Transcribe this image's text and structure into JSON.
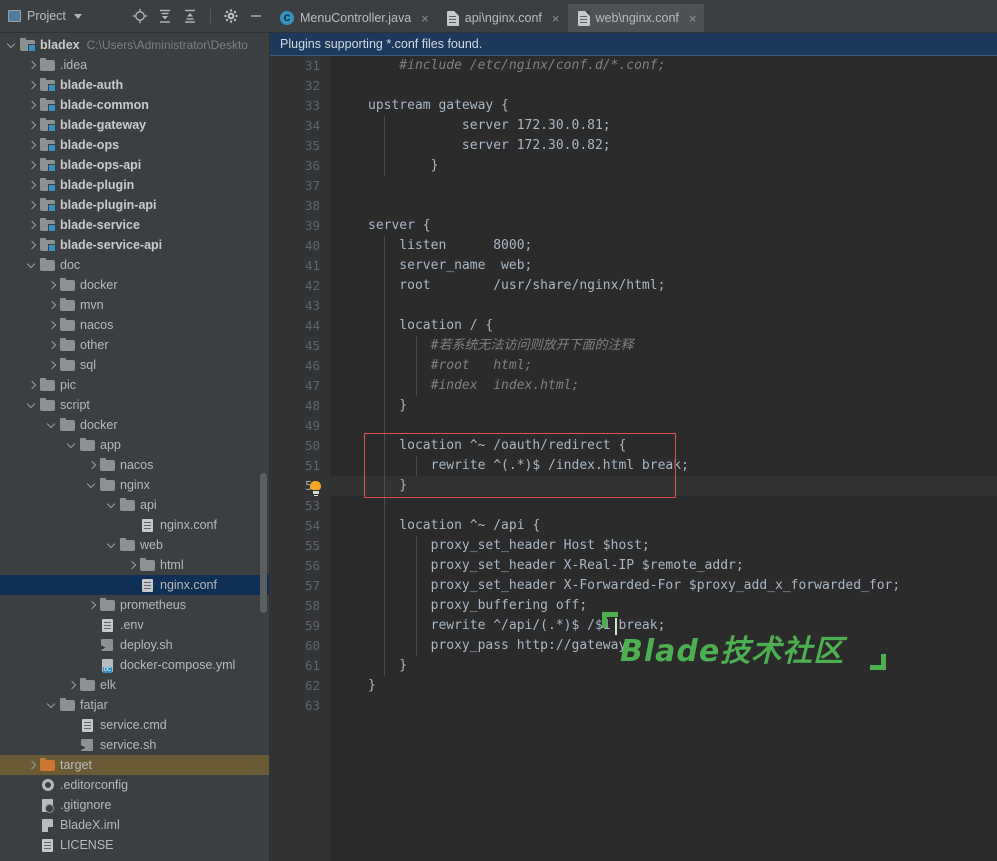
{
  "toolbar": {
    "project_label": "Project",
    "icons": [
      {
        "name": "locate-icon",
        "title": "Select Opened File"
      },
      {
        "name": "expand-all-icon",
        "title": "Expand All"
      },
      {
        "name": "collapse-all-icon",
        "title": "Collapse All"
      },
      {
        "name": "gear-icon",
        "title": "Settings"
      },
      {
        "name": "minimize-icon",
        "title": "Hide"
      }
    ]
  },
  "tabs": [
    {
      "label": "MenuController.java",
      "icon": "java-class-icon",
      "active": false,
      "close": "×"
    },
    {
      "label": "api\\nginx.conf",
      "icon": "conf-file-icon",
      "active": false,
      "close": "×"
    },
    {
      "label": "web\\nginx.conf",
      "icon": "conf-file-icon",
      "active": true,
      "close": "×"
    }
  ],
  "notification": {
    "text": "Plugins supporting *.conf files found."
  },
  "tree": [
    {
      "depth": 0,
      "arrow": "open",
      "icon": "module-folder",
      "label": "bladex",
      "bold": true,
      "path": "C:\\Users\\Administrator\\Deskto"
    },
    {
      "depth": 1,
      "arrow": "closed",
      "icon": "folder",
      "label": ".idea",
      "bold": false
    },
    {
      "depth": 1,
      "arrow": "closed",
      "icon": "module-folder",
      "label": "blade-auth",
      "bold": true
    },
    {
      "depth": 1,
      "arrow": "closed",
      "icon": "module-folder",
      "label": "blade-common",
      "bold": true
    },
    {
      "depth": 1,
      "arrow": "closed",
      "icon": "module-folder",
      "label": "blade-gateway",
      "bold": true
    },
    {
      "depth": 1,
      "arrow": "closed",
      "icon": "module-folder",
      "label": "blade-ops",
      "bold": true
    },
    {
      "depth": 1,
      "arrow": "closed",
      "icon": "module-folder",
      "label": "blade-ops-api",
      "bold": true
    },
    {
      "depth": 1,
      "arrow": "closed",
      "icon": "module-folder",
      "label": "blade-plugin",
      "bold": true
    },
    {
      "depth": 1,
      "arrow": "closed",
      "icon": "module-folder",
      "label": "blade-plugin-api",
      "bold": true
    },
    {
      "depth": 1,
      "arrow": "closed",
      "icon": "module-folder",
      "label": "blade-service",
      "bold": true
    },
    {
      "depth": 1,
      "arrow": "closed",
      "icon": "module-folder",
      "label": "blade-service-api",
      "bold": true
    },
    {
      "depth": 1,
      "arrow": "open",
      "icon": "folder",
      "label": "doc",
      "bold": false
    },
    {
      "depth": 2,
      "arrow": "closed",
      "icon": "folder",
      "label": "docker",
      "bold": false
    },
    {
      "depth": 2,
      "arrow": "closed",
      "icon": "folder",
      "label": "mvn",
      "bold": false
    },
    {
      "depth": 2,
      "arrow": "closed",
      "icon": "folder",
      "label": "nacos",
      "bold": false
    },
    {
      "depth": 2,
      "arrow": "closed",
      "icon": "folder",
      "label": "other",
      "bold": false
    },
    {
      "depth": 2,
      "arrow": "closed",
      "icon": "folder",
      "label": "sql",
      "bold": false
    },
    {
      "depth": 1,
      "arrow": "closed",
      "icon": "folder",
      "label": "pic",
      "bold": false
    },
    {
      "depth": 1,
      "arrow": "open",
      "icon": "folder",
      "label": "script",
      "bold": false
    },
    {
      "depth": 2,
      "arrow": "open",
      "icon": "folder",
      "label": "docker",
      "bold": false
    },
    {
      "depth": 3,
      "arrow": "open",
      "icon": "folder",
      "label": "app",
      "bold": false
    },
    {
      "depth": 4,
      "arrow": "closed",
      "icon": "folder",
      "label": "nacos",
      "bold": false
    },
    {
      "depth": 4,
      "arrow": "open",
      "icon": "folder",
      "label": "nginx",
      "bold": false
    },
    {
      "depth": 5,
      "arrow": "open",
      "icon": "folder",
      "label": "api",
      "bold": false
    },
    {
      "depth": 6,
      "arrow": "none",
      "icon": "conf-file",
      "label": "nginx.conf",
      "bold": false
    },
    {
      "depth": 5,
      "arrow": "open",
      "icon": "folder",
      "label": "web",
      "bold": false
    },
    {
      "depth": 6,
      "arrow": "closed",
      "icon": "folder",
      "label": "html",
      "bold": false
    },
    {
      "depth": 6,
      "arrow": "none",
      "icon": "conf-file",
      "label": "nginx.conf",
      "bold": false,
      "selected": "blue"
    },
    {
      "depth": 4,
      "arrow": "closed",
      "icon": "folder",
      "label": "prometheus",
      "bold": false
    },
    {
      "depth": 4,
      "arrow": "none",
      "icon": "conf-file",
      "label": ".env",
      "bold": false
    },
    {
      "depth": 4,
      "arrow": "none",
      "icon": "sh-file",
      "label": "deploy.sh",
      "bold": false
    },
    {
      "depth": 4,
      "arrow": "none",
      "icon": "yml-file",
      "label": "docker-compose.yml",
      "bold": false
    },
    {
      "depth": 3,
      "arrow": "closed",
      "icon": "folder",
      "label": "elk",
      "bold": false
    },
    {
      "depth": 2,
      "arrow": "open",
      "icon": "folder",
      "label": "fatjar",
      "bold": false
    },
    {
      "depth": 3,
      "arrow": "none",
      "icon": "conf-file",
      "label": "service.cmd",
      "bold": false
    },
    {
      "depth": 3,
      "arrow": "none",
      "icon": "sh-file",
      "label": "service.sh",
      "bold": false
    },
    {
      "depth": 1,
      "arrow": "closed",
      "icon": "orange-folder",
      "label": "target",
      "bold": false,
      "selected": "tan"
    },
    {
      "depth": 1,
      "arrow": "none",
      "icon": "gear-file",
      "label": ".editorconfig",
      "bold": false
    },
    {
      "depth": 1,
      "arrow": "none",
      "icon": "git-file",
      "label": ".gitignore",
      "bold": false
    },
    {
      "depth": 1,
      "arrow": "none",
      "icon": "iml-file",
      "label": "BladeX.iml",
      "bold": false
    },
    {
      "depth": 1,
      "arrow": "none",
      "icon": "conf-file",
      "label": "LICENSE",
      "bold": false
    }
  ],
  "editor": {
    "first_line_number": 31,
    "current_line": 52,
    "lines": [
      {
        "n": 31,
        "text": "    #include /etc/nginx/conf.d/*.conf;",
        "style": "comment"
      },
      {
        "n": 32,
        "text": "",
        "style": "code"
      },
      {
        "n": 33,
        "text": "upstream gateway {",
        "style": "code"
      },
      {
        "n": 34,
        "text": "            server 172.30.0.81;",
        "style": "code"
      },
      {
        "n": 35,
        "text": "            server 172.30.0.82;",
        "style": "code"
      },
      {
        "n": 36,
        "text": "        }",
        "style": "code"
      },
      {
        "n": 37,
        "text": "",
        "style": "code"
      },
      {
        "n": 38,
        "text": "",
        "style": "code"
      },
      {
        "n": 39,
        "text": "server {",
        "style": "code"
      },
      {
        "n": 40,
        "text": "    listen      8000;",
        "style": "code"
      },
      {
        "n": 41,
        "text": "    server_name  web;",
        "style": "code"
      },
      {
        "n": 42,
        "text": "    root        /usr/share/nginx/html;",
        "style": "code"
      },
      {
        "n": 43,
        "text": "",
        "style": "code"
      },
      {
        "n": 44,
        "text": "    location / {",
        "style": "code"
      },
      {
        "n": 45,
        "text": "        #若系统无法访问则放开下面的注释",
        "style": "comment"
      },
      {
        "n": 46,
        "text": "        #root   html;",
        "style": "comment"
      },
      {
        "n": 47,
        "text": "        #index  index.html;",
        "style": "comment"
      },
      {
        "n": 48,
        "text": "    }",
        "style": "code"
      },
      {
        "n": 49,
        "text": "",
        "style": "code"
      },
      {
        "n": 50,
        "text": "    location ^~ /oauth/redirect {",
        "style": "code"
      },
      {
        "n": 51,
        "text": "        rewrite ^(.*)$ /index.html break;",
        "style": "code"
      },
      {
        "n": 52,
        "text": "    }",
        "style": "code"
      },
      {
        "n": 53,
        "text": "",
        "style": "code"
      },
      {
        "n": 54,
        "text": "    location ^~ /api {",
        "style": "code"
      },
      {
        "n": 55,
        "text": "        proxy_set_header Host $host;",
        "style": "code"
      },
      {
        "n": 56,
        "text": "        proxy_set_header X-Real-IP $remote_addr;",
        "style": "code"
      },
      {
        "n": 57,
        "text": "        proxy_set_header X-Forwarded-For $proxy_add_x_forwarded_for;",
        "style": "code"
      },
      {
        "n": 58,
        "text": "        proxy_buffering off;",
        "style": "code"
      },
      {
        "n": 59,
        "text": "        rewrite ^/api/(.*)$ /$1 break;",
        "style": "code"
      },
      {
        "n": 60,
        "text": "        proxy_pass http://gateway;",
        "style": "code"
      },
      {
        "n": 61,
        "text": "    }",
        "style": "code"
      },
      {
        "n": 62,
        "text": "}",
        "style": "code"
      },
      {
        "n": 63,
        "text": "",
        "style": "code"
      }
    ],
    "highlight_box": {
      "from_line": 50,
      "to_line": 52,
      "color": "#e05050"
    },
    "gutter_bulb_line": 52,
    "watermark": "Blade技术社区",
    "watermark_color": "#4caf50"
  },
  "colors": {
    "chrome": "#3c3f41",
    "editor_bg": "#2b2b2b",
    "gutter_bg": "#313335",
    "notif_bg": "#1d3a5c",
    "selection_blue": "#0d3054",
    "selection_tan": "#6b5b35",
    "accent_blue": "#3592c4",
    "comment": "#808080",
    "code_fg": "#a9b7c6"
  }
}
